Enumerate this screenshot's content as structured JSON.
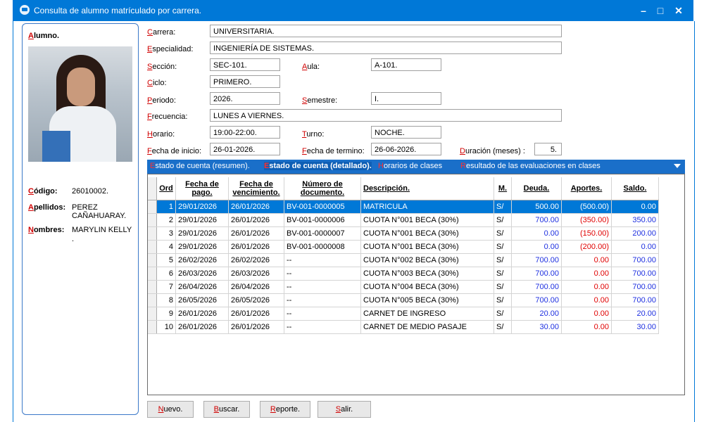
{
  "window": {
    "title": "Consulta de alumno matrículado por carrera.",
    "minimize": "–",
    "maximize": "□",
    "close": "✕"
  },
  "student": {
    "section_label_first": "A",
    "section_label_rest": "lumno.",
    "codigo_first": "C",
    "codigo_rest": "ódigo:",
    "codigo_value": "26010002.",
    "apellidos_first": "A",
    "apellidos_rest": "pellidos:",
    "apellidos_value_1": "PEREZ",
    "apellidos_value_2": "CAÑAHUARAY.",
    "nombres_first": "N",
    "nombres_rest": "ombres:",
    "nombres_value": "MARYLIN KELLY",
    "nombres_value_2": "."
  },
  "form": {
    "carrera_first": "C",
    "carrera_rest": "arrera:",
    "carrera_value": "UNIVERSITARIA.",
    "especialidad_first": "E",
    "especialidad_rest": "specialidad:",
    "especialidad_value": "INGENIERÍA DE SISTEMAS.",
    "seccion_first": "S",
    "seccion_rest": "ección:",
    "seccion_value": "SEC-101.",
    "aula_first": "A",
    "aula_rest": "ula:",
    "aula_value": "A-101.",
    "ciclo_first": "C",
    "ciclo_rest": "iclo:",
    "ciclo_value": "PRIMERO.",
    "periodo_first": "P",
    "periodo_rest": "eriodo:",
    "periodo_value": "2026.",
    "semestre_first": "S",
    "semestre_rest": "emestre:",
    "semestre_value": "I.",
    "frecuencia_first": "F",
    "frecuencia_rest": "recuencia:",
    "frecuencia_value": "LUNES A VIERNES.",
    "horario_first": "H",
    "horario_rest": "orario:",
    "horario_value": "19:00-22:00.",
    "turno_first": "T",
    "turno_rest": "urno:",
    "turno_value": "NOCHE.",
    "inicio_first": "F",
    "inicio_rest": "echa de inicio:",
    "inicio_value": "26-01-2026.",
    "termino_first": "F",
    "termino_rest": "echa de termino:",
    "termino_value": "26-06-2026.",
    "duracion_first": "D",
    "duracion_rest": "uración (meses) :",
    "duracion_value": "5."
  },
  "tabs": [
    {
      "first": "E",
      "rest": "stado de cuenta (resumen)."
    },
    {
      "first": "E",
      "rest": "stado de cuenta (detallado)."
    },
    {
      "first": "H",
      "rest": "orarios de clases"
    },
    {
      "first": "R",
      "rest": "esultado de las evaluaciones en clases"
    }
  ],
  "table": {
    "headers": [
      "Ord",
      "Fecha de pago.",
      "Fecha de vencimiento.",
      "Número de documento.",
      "Descripción.",
      "M.",
      "Deuda.",
      "Aportes.",
      "Saldo."
    ],
    "rows": [
      [
        "1",
        "29/01/2026",
        "26/01/2026",
        "BV-001-0000005",
        "MATRICULA",
        "S/",
        "500.00",
        "(500.00)",
        "0.00"
      ],
      [
        "2",
        "29/01/2026",
        "26/01/2026",
        "BV-001-0000006",
        "CUOTA N°001  BECA (30%)",
        "S/",
        "700.00",
        "(350.00)",
        "350.00"
      ],
      [
        "3",
        "29/01/2026",
        "26/01/2026",
        "BV-001-0000007",
        "CUOTA N°001  BECA (30%)",
        "S/",
        "0.00",
        "(150.00)",
        "200.00"
      ],
      [
        "4",
        "29/01/2026",
        "26/01/2026",
        "BV-001-0000008",
        "CUOTA N°001  BECA (30%)",
        "S/",
        "0.00",
        "(200.00)",
        "0.00"
      ],
      [
        "5",
        "26/02/2026",
        "26/02/2026",
        "--",
        "CUOTA N°002  BECA (30%)",
        "S/",
        "700.00",
        "0.00",
        "700.00"
      ],
      [
        "6",
        "26/03/2026",
        "26/03/2026",
        "--",
        "CUOTA N°003  BECA (30%)",
        "S/",
        "700.00",
        "0.00",
        "700.00"
      ],
      [
        "7",
        "26/04/2026",
        "26/04/2026",
        "--",
        "CUOTA N°004  BECA (30%)",
        "S/",
        "700.00",
        "0.00",
        "700.00"
      ],
      [
        "8",
        "26/05/2026",
        "26/05/2026",
        "--",
        "CUOTA N°005  BECA (30%)",
        "S/",
        "700.00",
        "0.00",
        "700.00"
      ],
      [
        "9",
        "26/01/2026",
        "26/01/2026",
        "--",
        "CARNET DE INGRESO",
        "S/",
        "20.00",
        "0.00",
        "20.00"
      ],
      [
        "10",
        "26/01/2026",
        "26/01/2026",
        "--",
        "CARNET DE MEDIO PASAJE",
        "S/",
        "30.00",
        "0.00",
        "30.00"
      ]
    ]
  },
  "buttons": [
    {
      "first": "N",
      "rest": "uevo."
    },
    {
      "first": "B",
      "rest": "uscar."
    },
    {
      "first": "R",
      "rest": "eporte."
    },
    {
      "first": "S",
      "rest": "alir."
    }
  ],
  "colors": {
    "titlebar": "#0078d7",
    "accent_red": "#d00000",
    "debt_blue": "#1d2fe0",
    "credit_red": "#e00000",
    "selection": "#0078d7"
  }
}
